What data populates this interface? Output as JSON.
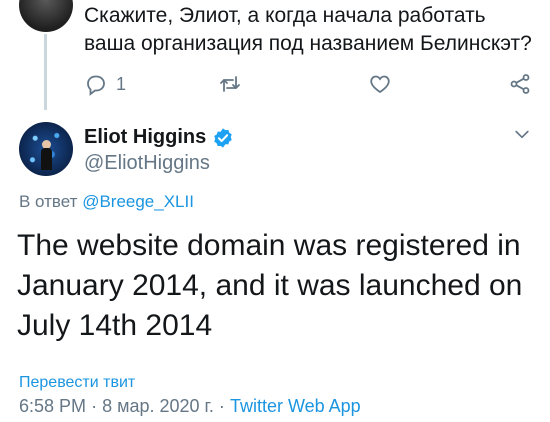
{
  "previous_tweet": {
    "text": "Скажите, Элиот, а когда начала работать ваша организация под названием Белинскэт?",
    "reply_count": "1"
  },
  "tweet": {
    "display_name": "Eliot Higgins",
    "handle": "@EliotHiggins",
    "reply_prefix": "В ответ",
    "reply_mention": "@Breege_XLII",
    "text": "The website domain was registered in January 2014, and it was launched on July 14th 2014",
    "translate_label": "Перевести твит",
    "time": "6:58 PM",
    "date": "8 мар. 2020 г.",
    "separator": "·",
    "source": "Twitter Web App"
  },
  "colors": {
    "accent": "#1b95e0",
    "secondary_text": "#657786",
    "verified": "#1da1f2"
  },
  "icons": [
    "reply-icon",
    "retweet-icon",
    "like-icon",
    "share-icon",
    "verified-icon",
    "chevron-down-icon"
  ]
}
